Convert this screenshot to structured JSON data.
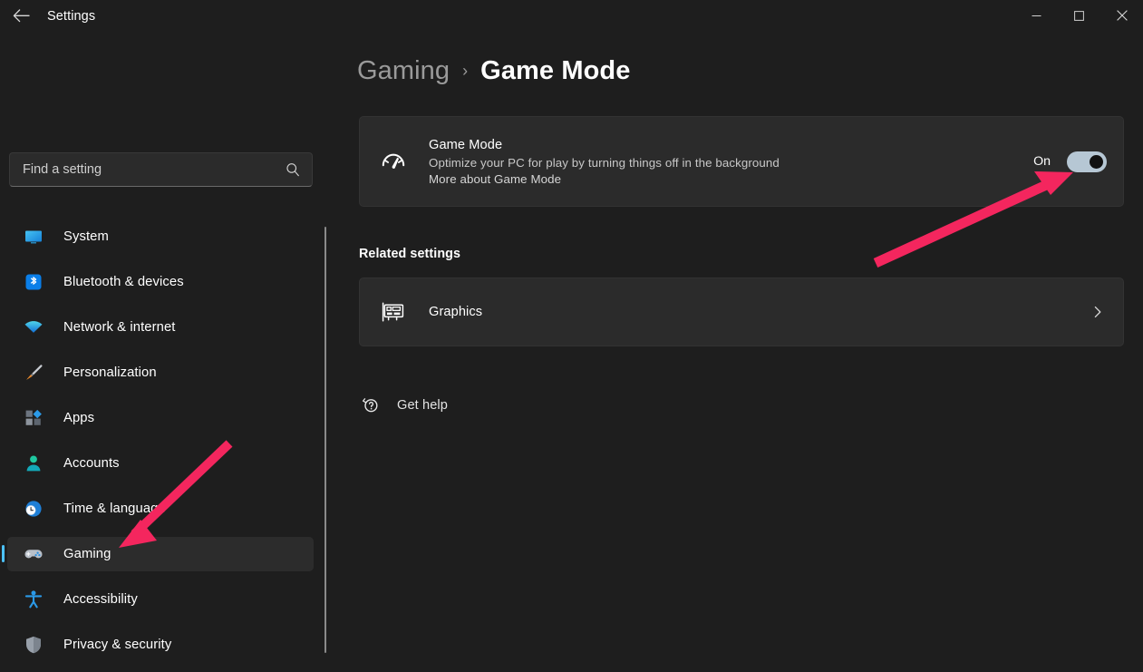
{
  "window": {
    "title": "Settings",
    "back_icon": "back-arrow-icon",
    "controls": {
      "minimize": "minimize-icon",
      "maximize": "maximize-icon",
      "close": "close-icon"
    }
  },
  "search": {
    "placeholder": "Find a setting",
    "value": "",
    "icon": "search-icon"
  },
  "sidebar": {
    "items": [
      {
        "label": "System",
        "icon": "monitor-icon",
        "selected": false
      },
      {
        "label": "Bluetooth & devices",
        "icon": "bluetooth-icon",
        "selected": false
      },
      {
        "label": "Network & internet",
        "icon": "wifi-icon",
        "selected": false
      },
      {
        "label": "Personalization",
        "icon": "paintbrush-icon",
        "selected": false
      },
      {
        "label": "Apps",
        "icon": "apps-icon",
        "selected": false
      },
      {
        "label": "Accounts",
        "icon": "person-icon",
        "selected": false
      },
      {
        "label": "Time & language",
        "icon": "clock-globe-icon",
        "selected": false
      },
      {
        "label": "Gaming",
        "icon": "gamepad-icon",
        "selected": true
      },
      {
        "label": "Accessibility",
        "icon": "accessibility-icon",
        "selected": false
      },
      {
        "label": "Privacy & security",
        "icon": "shield-icon",
        "selected": false
      }
    ]
  },
  "breadcrumb": {
    "parent": "Gaming",
    "separator": "›",
    "current": "Game Mode"
  },
  "game_mode_card": {
    "icon": "speedometer-icon",
    "title": "Game Mode",
    "description": "Optimize your PC for play by turning things off in the background",
    "link": "More about Game Mode",
    "toggle_state": "On",
    "toggle_on": true
  },
  "related_settings": {
    "heading": "Related settings",
    "rows": [
      {
        "label": "Graphics",
        "icon": "graphics-card-icon",
        "chevron": "chevron-right-icon"
      }
    ]
  },
  "get_help": {
    "label": "Get help",
    "icon": "help-bubble-icon"
  },
  "colors": {
    "accent": "#4cc2ff",
    "annotation_arrow": "#f4265e",
    "window_bg": "#1e1e1e",
    "card_bg": "#2b2b2b",
    "toggle_on_track": "#b6c7d4"
  },
  "annotations": [
    {
      "name": "arrow-to-toggle",
      "color": "#f4265e"
    },
    {
      "name": "arrow-to-gaming-nav",
      "color": "#f4265e"
    }
  ]
}
